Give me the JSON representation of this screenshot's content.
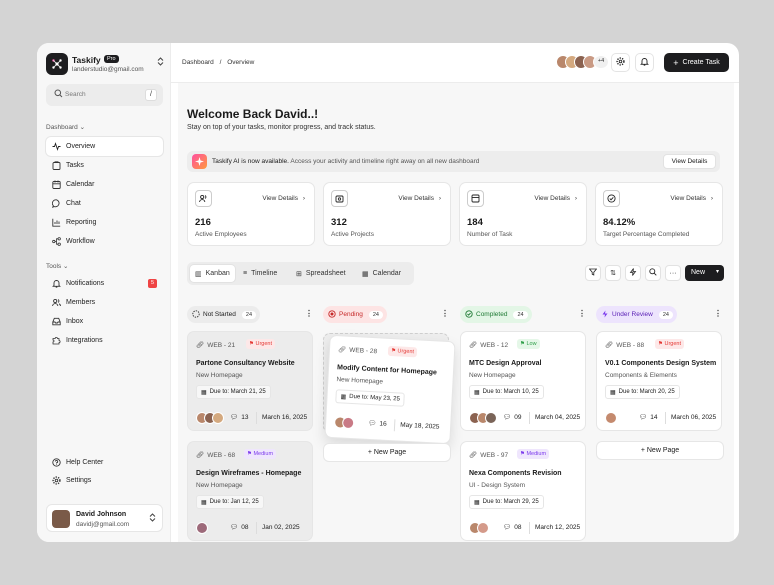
{
  "brand": {
    "name": "Taskify",
    "badge": "Pro",
    "email": "landerstudio@gmail.com"
  },
  "search": {
    "placeholder": "Search",
    "shortcut": "/"
  },
  "sidebar": {
    "section_dashboard": "Dashboard",
    "dashboard_items": [
      {
        "label": "Overview",
        "icon": "activity-icon"
      },
      {
        "label": "Tasks",
        "icon": "clipboard-icon"
      },
      {
        "label": "Calendar",
        "icon": "calendar-icon"
      },
      {
        "label": "Chat",
        "icon": "chat-icon"
      },
      {
        "label": "Reporting",
        "icon": "chart-icon"
      },
      {
        "label": "Workflow",
        "icon": "workflow-icon"
      }
    ],
    "section_tools": "Tools",
    "tools_items": [
      {
        "label": "Notifications",
        "icon": "bell-icon",
        "badge": "5"
      },
      {
        "label": "Members",
        "icon": "users-icon"
      },
      {
        "label": "Inbox",
        "icon": "inbox-icon"
      },
      {
        "label": "Integrations",
        "icon": "puzzle-icon"
      }
    ],
    "bottom_items": [
      {
        "label": "Help Center",
        "icon": "help-icon"
      },
      {
        "label": "Settings",
        "icon": "settings-icon"
      }
    ]
  },
  "user": {
    "name": "David Johnson",
    "email": "davidj@gmail.com"
  },
  "topbar": {
    "crumb_root": "Dashboard",
    "crumb_sep": "/",
    "crumb_current": "Overview",
    "avatar_more": "+4",
    "create_label": "Create Task"
  },
  "welcome": {
    "title": "Welcome Back David..!",
    "subtitle": "Stay on top of your tasks, monitor progress, and track status."
  },
  "banner": {
    "strong": "Taskify AI is now available.",
    "text": " Access your activity and timeline right away on all new dashboard",
    "button": "View Details"
  },
  "stats": [
    {
      "value": "216",
      "label": "Active Employees",
      "link": "View Details"
    },
    {
      "value": "312",
      "label": "Active Projects",
      "link": "View Details"
    },
    {
      "value": "184",
      "label": "Number of Task",
      "link": "View Details"
    },
    {
      "value": "84.12%",
      "label": "Target Percentage Completed",
      "link": "View Details"
    }
  ],
  "views": {
    "tabs": [
      "Kanban",
      "Timeline",
      "Spreadsheet",
      "Calendar"
    ],
    "new_label": "New"
  },
  "columns": [
    {
      "title": "Not Started",
      "count": "24",
      "color": "#ececec",
      "text": "#1a1a1a"
    },
    {
      "title": "Pending",
      "count": "24",
      "color": "#fde4e4",
      "text": "#c62828"
    },
    {
      "title": "Completed",
      "count": "24",
      "color": "#e3f6e6",
      "text": "#1f7a35"
    },
    {
      "title": "Under Review",
      "count": "24",
      "color": "#ede4fd",
      "text": "#5b21b6"
    }
  ],
  "cards": {
    "c1": {
      "id": "WEB - 21",
      "priority": "Urgent",
      "title": "Partone Consultancy Website",
      "sub": "New Homepage",
      "due": "Due to: March 21, 25",
      "comments": "13",
      "date": "March 16, 2025"
    },
    "c2": {
      "id": "WEB - 68",
      "priority": "Medium",
      "title": "Design Wireframes - Homepage",
      "sub": "New Homepage",
      "due": "Due to: Jan 12, 25",
      "comments": "08",
      "date": "Jan 02, 2025"
    },
    "c3": {
      "id": "WEB - 28",
      "priority": "Urgent",
      "title": "Modify Content for Homepage",
      "sub": "New Homepage",
      "due": "Due to: May 23, 25",
      "comments": "16",
      "date": "May 18, 2025"
    },
    "c4": {
      "id": "WEB - 12",
      "priority": "Low",
      "title": "MTC Design Approval",
      "sub": "New Homepage",
      "due": "Due to: March 10, 25",
      "comments": "09",
      "date": "March 04, 2025"
    },
    "c5": {
      "id": "WEB - 97",
      "priority": "Medium",
      "title": "Nexa Components Revision",
      "sub": "UI - Design System",
      "due": "Due to: March 29, 25",
      "comments": "08",
      "date": "March 12, 2025"
    },
    "c6": {
      "id": "WEB - 88",
      "priority": "Urgent",
      "title": "V0.1 Components Design System",
      "sub": "Components & Elements",
      "due": "Due to: March 20, 25",
      "comments": "14",
      "date": "March 06, 2025"
    }
  },
  "new_page": "New Page"
}
